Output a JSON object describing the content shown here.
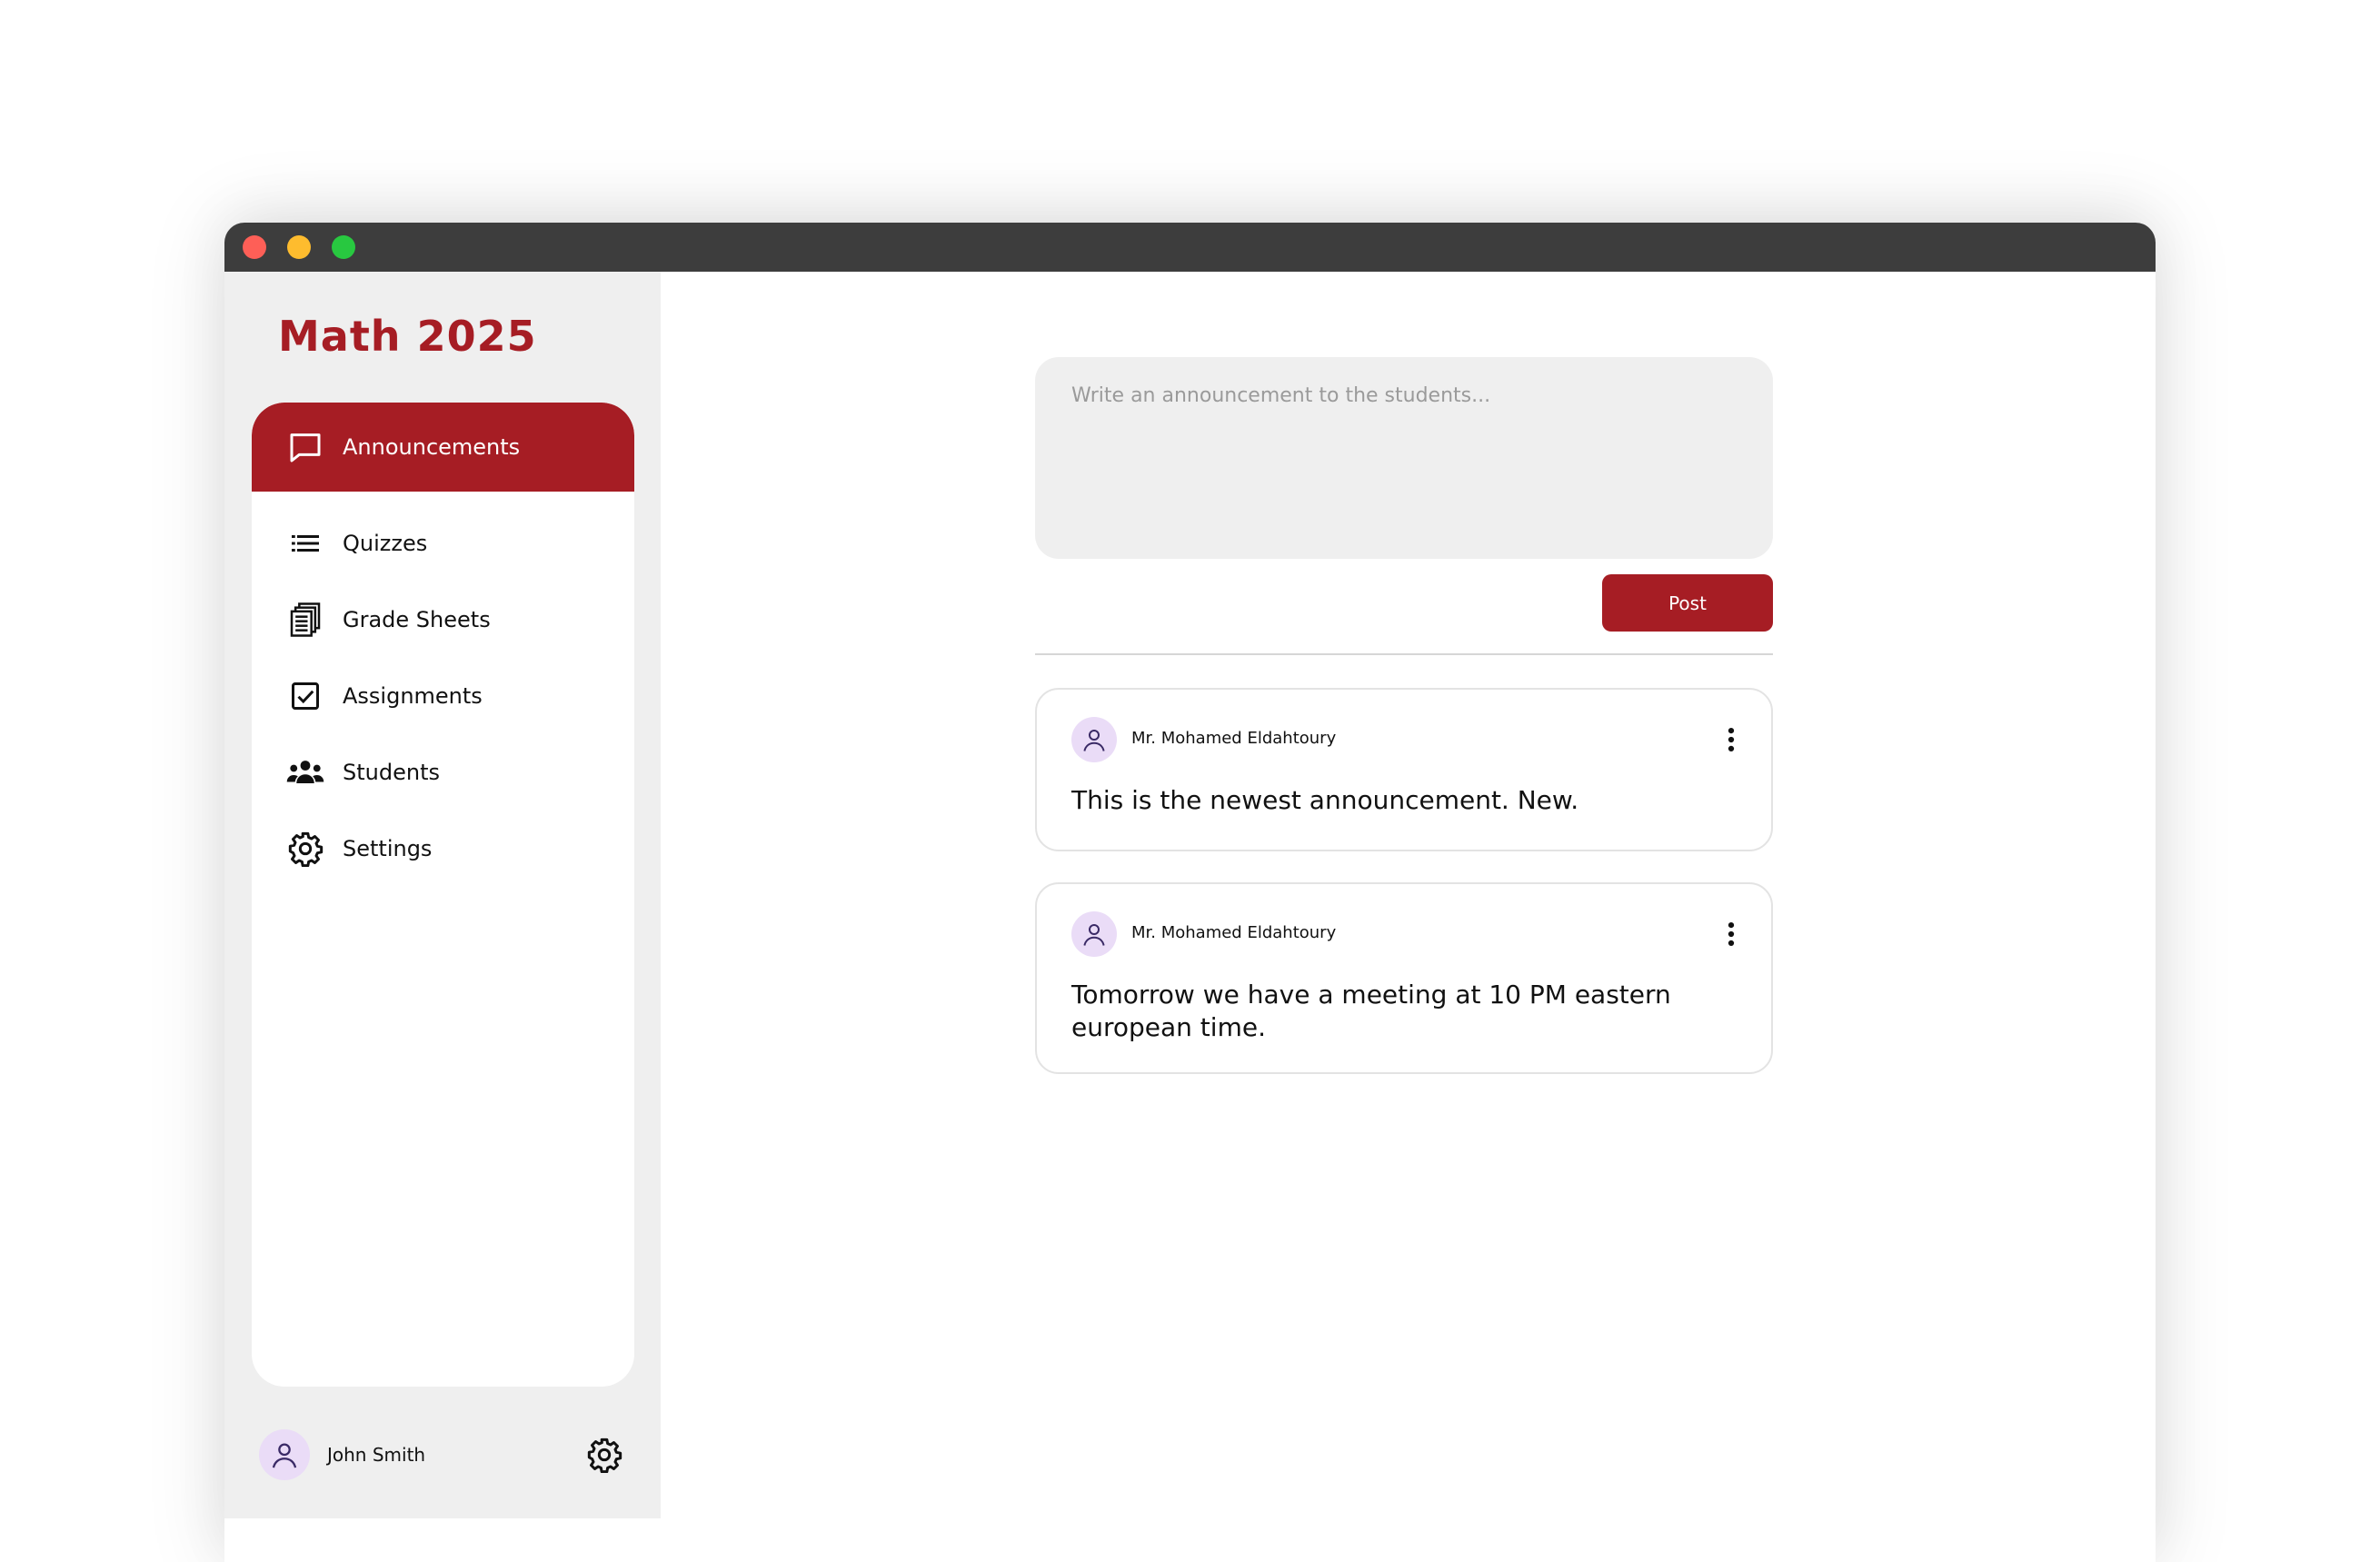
{
  "sidebar": {
    "brand": "Math 2025",
    "items": [
      {
        "label": "Announcements",
        "icon": "chat-bubble-icon",
        "active": true
      },
      {
        "label": "Quizzes",
        "icon": "list-icon"
      },
      {
        "label": "Grade Sheets",
        "icon": "documents-icon"
      },
      {
        "label": "Assignments",
        "icon": "checkbox-icon"
      },
      {
        "label": "Students",
        "icon": "people-icon"
      },
      {
        "label": "Settings",
        "icon": "gear-icon"
      }
    ],
    "user": {
      "name": "John Smith"
    }
  },
  "composer": {
    "placeholder": "Write an announcement to the students...",
    "post_label": "Post"
  },
  "announcements": [
    {
      "author": "Mr. Mohamed Eldahtoury",
      "text": "This is the newest announcement. New."
    },
    {
      "author": "Mr. Mohamed Eldahtoury",
      "text": "Tomorrow we have a meeting at 10 PM eastern european time."
    }
  ],
  "colors": {
    "accent": "#a61d24",
    "panel": "#efefef",
    "avatar_bg": "#eadcf7"
  }
}
